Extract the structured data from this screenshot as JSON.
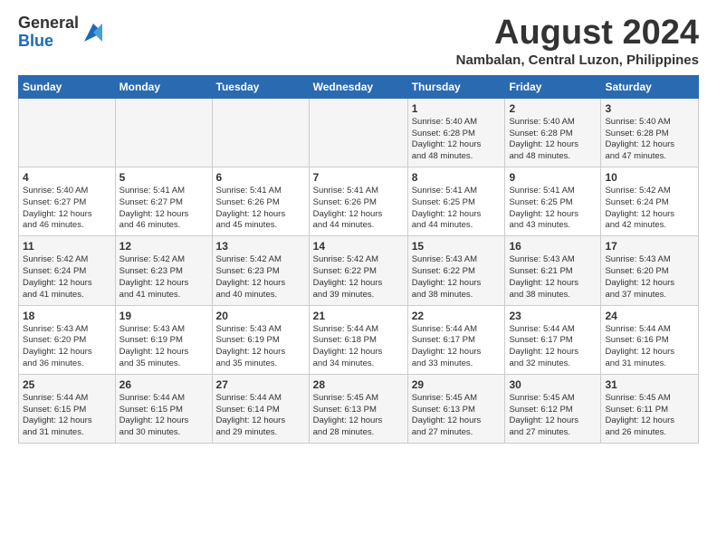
{
  "logo": {
    "general": "General",
    "blue": "Blue"
  },
  "title": "August 2024",
  "location": "Nambalan, Central Luzon, Philippines",
  "days_of_week": [
    "Sunday",
    "Monday",
    "Tuesday",
    "Wednesday",
    "Thursday",
    "Friday",
    "Saturday"
  ],
  "weeks": [
    [
      {
        "day": "",
        "info": ""
      },
      {
        "day": "",
        "info": ""
      },
      {
        "day": "",
        "info": ""
      },
      {
        "day": "",
        "info": ""
      },
      {
        "day": "1",
        "info": "Sunrise: 5:40 AM\nSunset: 6:28 PM\nDaylight: 12 hours\nand 48 minutes."
      },
      {
        "day": "2",
        "info": "Sunrise: 5:40 AM\nSunset: 6:28 PM\nDaylight: 12 hours\nand 48 minutes."
      },
      {
        "day": "3",
        "info": "Sunrise: 5:40 AM\nSunset: 6:28 PM\nDaylight: 12 hours\nand 47 minutes."
      }
    ],
    [
      {
        "day": "4",
        "info": "Sunrise: 5:40 AM\nSunset: 6:27 PM\nDaylight: 12 hours\nand 46 minutes."
      },
      {
        "day": "5",
        "info": "Sunrise: 5:41 AM\nSunset: 6:27 PM\nDaylight: 12 hours\nand 46 minutes."
      },
      {
        "day": "6",
        "info": "Sunrise: 5:41 AM\nSunset: 6:26 PM\nDaylight: 12 hours\nand 45 minutes."
      },
      {
        "day": "7",
        "info": "Sunrise: 5:41 AM\nSunset: 6:26 PM\nDaylight: 12 hours\nand 44 minutes."
      },
      {
        "day": "8",
        "info": "Sunrise: 5:41 AM\nSunset: 6:25 PM\nDaylight: 12 hours\nand 44 minutes."
      },
      {
        "day": "9",
        "info": "Sunrise: 5:41 AM\nSunset: 6:25 PM\nDaylight: 12 hours\nand 43 minutes."
      },
      {
        "day": "10",
        "info": "Sunrise: 5:42 AM\nSunset: 6:24 PM\nDaylight: 12 hours\nand 42 minutes."
      }
    ],
    [
      {
        "day": "11",
        "info": "Sunrise: 5:42 AM\nSunset: 6:24 PM\nDaylight: 12 hours\nand 41 minutes."
      },
      {
        "day": "12",
        "info": "Sunrise: 5:42 AM\nSunset: 6:23 PM\nDaylight: 12 hours\nand 41 minutes."
      },
      {
        "day": "13",
        "info": "Sunrise: 5:42 AM\nSunset: 6:23 PM\nDaylight: 12 hours\nand 40 minutes."
      },
      {
        "day": "14",
        "info": "Sunrise: 5:42 AM\nSunset: 6:22 PM\nDaylight: 12 hours\nand 39 minutes."
      },
      {
        "day": "15",
        "info": "Sunrise: 5:43 AM\nSunset: 6:22 PM\nDaylight: 12 hours\nand 38 minutes."
      },
      {
        "day": "16",
        "info": "Sunrise: 5:43 AM\nSunset: 6:21 PM\nDaylight: 12 hours\nand 38 minutes."
      },
      {
        "day": "17",
        "info": "Sunrise: 5:43 AM\nSunset: 6:20 PM\nDaylight: 12 hours\nand 37 minutes."
      }
    ],
    [
      {
        "day": "18",
        "info": "Sunrise: 5:43 AM\nSunset: 6:20 PM\nDaylight: 12 hours\nand 36 minutes."
      },
      {
        "day": "19",
        "info": "Sunrise: 5:43 AM\nSunset: 6:19 PM\nDaylight: 12 hours\nand 35 minutes."
      },
      {
        "day": "20",
        "info": "Sunrise: 5:43 AM\nSunset: 6:19 PM\nDaylight: 12 hours\nand 35 minutes."
      },
      {
        "day": "21",
        "info": "Sunrise: 5:44 AM\nSunset: 6:18 PM\nDaylight: 12 hours\nand 34 minutes."
      },
      {
        "day": "22",
        "info": "Sunrise: 5:44 AM\nSunset: 6:17 PM\nDaylight: 12 hours\nand 33 minutes."
      },
      {
        "day": "23",
        "info": "Sunrise: 5:44 AM\nSunset: 6:17 PM\nDaylight: 12 hours\nand 32 minutes."
      },
      {
        "day": "24",
        "info": "Sunrise: 5:44 AM\nSunset: 6:16 PM\nDaylight: 12 hours\nand 31 minutes."
      }
    ],
    [
      {
        "day": "25",
        "info": "Sunrise: 5:44 AM\nSunset: 6:15 PM\nDaylight: 12 hours\nand 31 minutes."
      },
      {
        "day": "26",
        "info": "Sunrise: 5:44 AM\nSunset: 6:15 PM\nDaylight: 12 hours\nand 30 minutes."
      },
      {
        "day": "27",
        "info": "Sunrise: 5:44 AM\nSunset: 6:14 PM\nDaylight: 12 hours\nand 29 minutes."
      },
      {
        "day": "28",
        "info": "Sunrise: 5:45 AM\nSunset: 6:13 PM\nDaylight: 12 hours\nand 28 minutes."
      },
      {
        "day": "29",
        "info": "Sunrise: 5:45 AM\nSunset: 6:13 PM\nDaylight: 12 hours\nand 27 minutes."
      },
      {
        "day": "30",
        "info": "Sunrise: 5:45 AM\nSunset: 6:12 PM\nDaylight: 12 hours\nand 27 minutes."
      },
      {
        "day": "31",
        "info": "Sunrise: 5:45 AM\nSunset: 6:11 PM\nDaylight: 12 hours\nand 26 minutes."
      }
    ]
  ]
}
